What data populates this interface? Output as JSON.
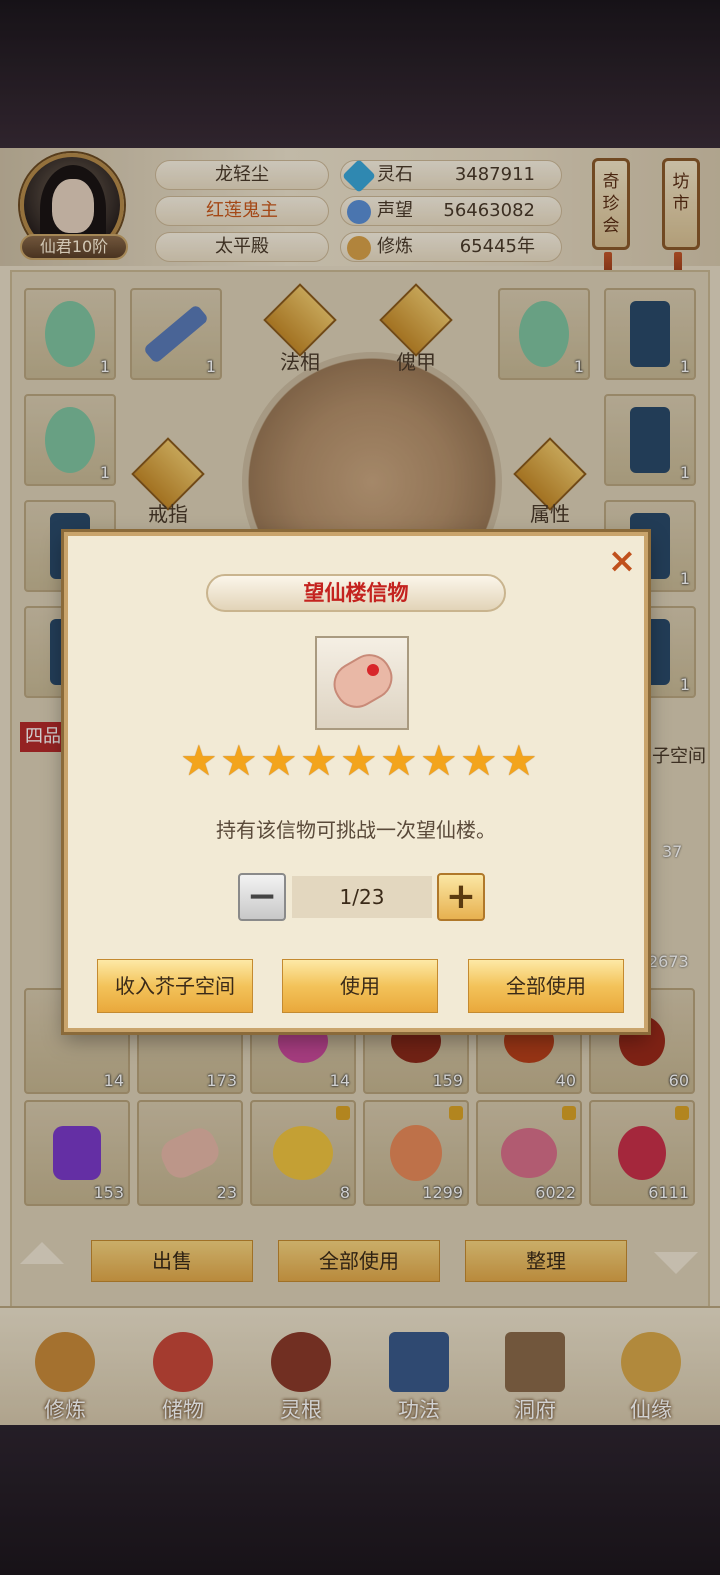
{
  "header": {
    "player_name": "龙轻尘",
    "title": "红莲鬼主",
    "sect": "太平殿",
    "rank": "仙君10阶",
    "resources": [
      {
        "label": "灵石",
        "value": "3487911",
        "icon": "spirit-stone-icon",
        "color": "#3aa7d8"
      },
      {
        "label": "声望",
        "value": "56463082",
        "icon": "prestige-icon",
        "color": "#5b8fd6"
      },
      {
        "label": "修炼",
        "value": "65445年",
        "icon": "meditation-icon",
        "color": "#d8a24a"
      }
    ],
    "banners": {
      "left": "奇珍会",
      "right": "坊市"
    }
  },
  "equipment": {
    "labels": {
      "top_left": "法相",
      "top_right": "傀甲",
      "mid_left": "戒指",
      "mid_right": "属性"
    },
    "left_counts": [
      "1",
      "1",
      "1",
      "1"
    ],
    "right_counts": [
      "1",
      "1",
      "1",
      "1",
      "1",
      "1"
    ],
    "category_tag": "四品",
    "space_label": "子空间"
  },
  "inventory": {
    "row_partial_counts": [
      "14",
      "173",
      "14",
      "159",
      "40",
      "60"
    ],
    "side_counts": [
      "37",
      "2673"
    ],
    "row_full": [
      {
        "count": "153",
        "icon": "purple-crystal-icon",
        "color": "#7a3ac8",
        "locked": false
      },
      {
        "count": "23",
        "icon": "scroll-icon",
        "color": "#e6b8a8",
        "locked": false
      },
      {
        "count": "8",
        "icon": "golden-flower-icon",
        "color": "#f0c440",
        "locked": true
      },
      {
        "count": "1299",
        "icon": "peach-icon",
        "color": "#e88a5a",
        "locked": true
      },
      {
        "count": "6022",
        "icon": "pink-fruit-icon",
        "color": "#d8708a",
        "locked": true
      },
      {
        "count": "6111",
        "icon": "raspberry-icon",
        "color": "#c8304a",
        "locked": true
      }
    ]
  },
  "actions": {
    "sell": "出售",
    "use_all": "全部使用",
    "sort": "整理"
  },
  "nav": [
    {
      "label": "修炼",
      "icon": "cultivation-icon",
      "color": "#c88a3a"
    },
    {
      "label": "储物",
      "icon": "storage-bag-icon",
      "color": "#c8483a"
    },
    {
      "label": "灵根",
      "icon": "spirit-root-icon",
      "color": "#8a3a2a"
    },
    {
      "label": "功法",
      "icon": "technique-book-icon",
      "color": "#3a5a8a"
    },
    {
      "label": "洞府",
      "icon": "cave-house-icon",
      "color": "#8a6a4a"
    },
    {
      "label": "仙缘",
      "icon": "destiny-icon",
      "color": "#d8a84a"
    }
  ],
  "modal": {
    "title": "望仙楼信物",
    "item_icon": "scroll-token-icon",
    "stars": 9,
    "description": "持有该信物可挑战一次望仙楼。",
    "quantity": "1/23",
    "minus": "−",
    "plus": "+",
    "close": "×",
    "buttons": {
      "store": "收入芥子空间",
      "use": "使用",
      "use_all": "全部使用"
    }
  }
}
